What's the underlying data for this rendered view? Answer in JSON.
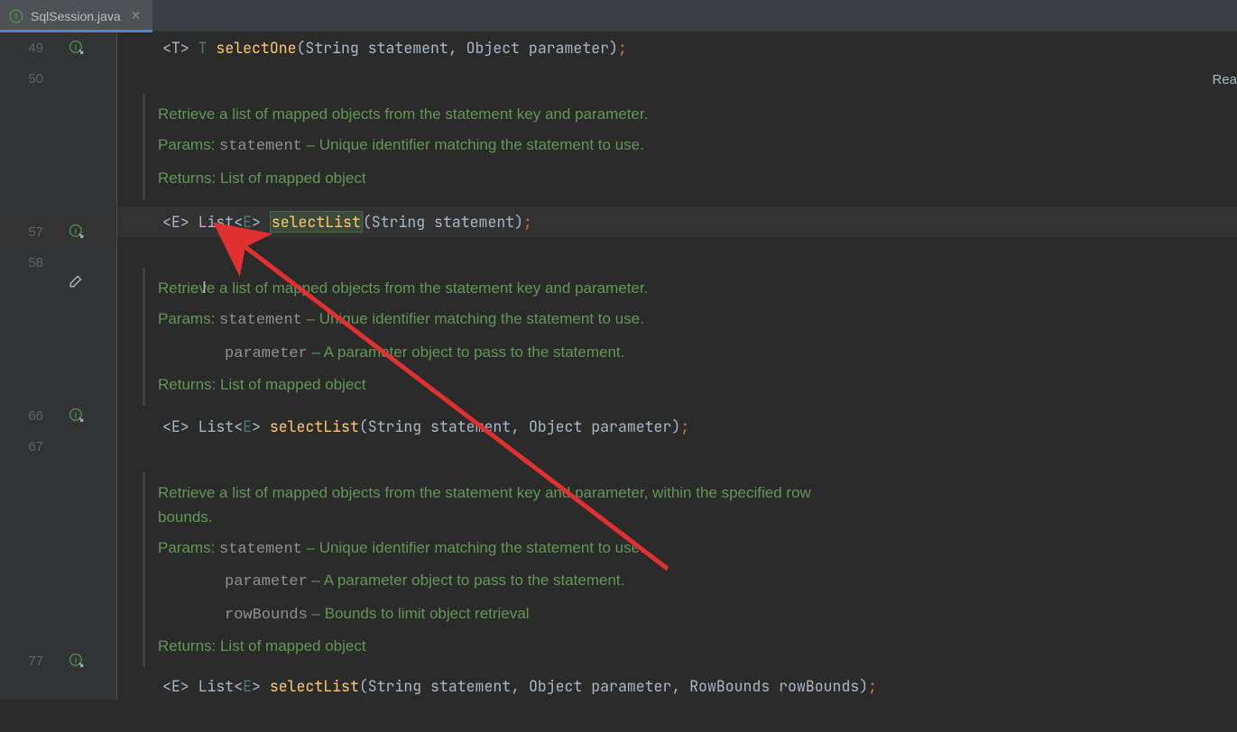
{
  "tab": {
    "label": "SqlSession.java"
  },
  "readonly_label": "Rea",
  "lines": {
    "l49": {
      "num": "49"
    },
    "l50": {
      "num": "50"
    },
    "l57": {
      "num": "57"
    },
    "l58": {
      "num": "58"
    },
    "l66": {
      "num": "66"
    },
    "l67": {
      "num": "67"
    },
    "l77": {
      "num": "77"
    }
  },
  "code": {
    "c49_open": "<T>",
    "c49_ret": "T",
    "c49_method": "selectOne",
    "c49_params": "(String statement, Object parameter)",
    "c49_end": ";",
    "c57_open": "<E>",
    "c57_ret": "List",
    "c57_gen_open": "<",
    "c57_gen": "E",
    "c57_gen_close": ">",
    "c57_method": "selectList",
    "c57_params": "(String statement)",
    "c57_end": ";",
    "c66_open": "<E>",
    "c66_ret": "List",
    "c66_gen_open": "<",
    "c66_gen": "E",
    "c66_gen_close": ">",
    "c66_method": "selectList",
    "c66_params": "(String statement, Object parameter)",
    "c66_end": ";",
    "c77_open": "<E>",
    "c77_ret": "List",
    "c77_gen_open": "<",
    "c77_gen": "E",
    "c77_gen_close": ">",
    "c77_method": "selectList",
    "c77_params": "(String statement, Object parameter, RowBounds rowBounds)",
    "c77_end": ";"
  },
  "docs": {
    "d1": {
      "desc": "Retrieve a list of mapped objects from the statement key and parameter.",
      "params_label": "Params:",
      "p1_name": "statement",
      "p1_desc": " – Unique identifier matching the statement to use.",
      "returns_label": "Returns:",
      "returns_desc": " List of mapped object"
    },
    "d2": {
      "desc": "Retrieve a list of mapped objects from the statement key and parameter.",
      "params_label": "Params:",
      "p1_name": "statement",
      "p1_desc": " – Unique identifier matching the statement to use.",
      "p2_name": "parameter",
      "p2_desc": " – A parameter object to pass to the statement.",
      "returns_label": "Returns:",
      "returns_desc": " List of mapped object"
    },
    "d3": {
      "desc": "Retrieve a list of mapped objects from the statement key and parameter, within the specified row bounds.",
      "params_label": "Params:",
      "p1_name": "statement",
      "p1_desc": " – Unique identifier matching the statement to use.",
      "p2_name": "parameter",
      "p2_desc": " – A parameter object to pass to the statement.",
      "p3_name": "rowBounds",
      "p3_desc": " – Bounds to limit object retrieval",
      "returns_label": "Returns:",
      "returns_desc": " List of mapped object"
    }
  }
}
